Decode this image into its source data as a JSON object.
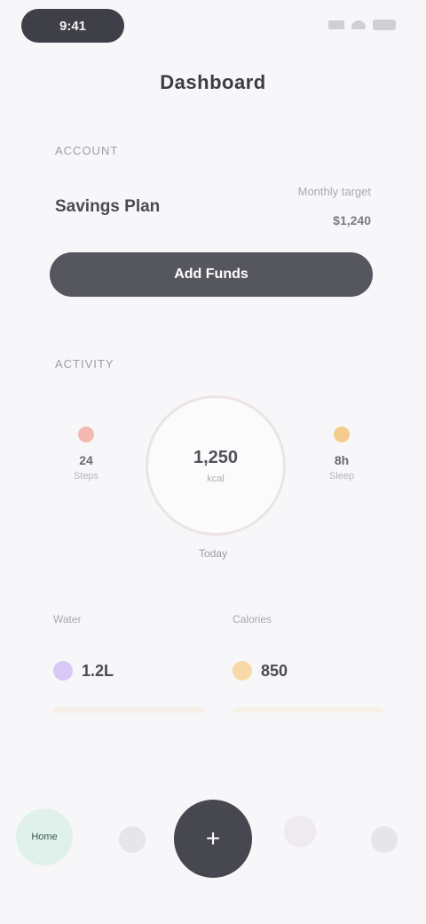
{
  "status_bar": {
    "time": "9:41"
  },
  "app": {
    "title": "Dashboard"
  },
  "account": {
    "section_label": "Account",
    "name": "Savings Plan",
    "rate": "Monthly target",
    "amount": "$1,240",
    "primary_button": "Add Funds"
  },
  "activity": {
    "section_label": "Activity",
    "left": {
      "value": "24",
      "label": "Steps",
      "color": "#f3b9b0"
    },
    "ring": {
      "value": "1,250",
      "sub": "kcal",
      "caption": "Today"
    },
    "right": {
      "value": "8h",
      "label": "Sleep",
      "color": "#f6cc8e"
    }
  },
  "cards": [
    {
      "title": "Water",
      "value": "1.2L",
      "icon_color": "#d7c9f5",
      "bar_color": "#f5efe7"
    },
    {
      "title": "Calories",
      "value": "850",
      "icon_color": "#f8d8a6",
      "bar_color": "#f7f0e6"
    }
  ],
  "nav": {
    "home": "Home",
    "a": "",
    "center": "+",
    "b": "",
    "c": ""
  }
}
